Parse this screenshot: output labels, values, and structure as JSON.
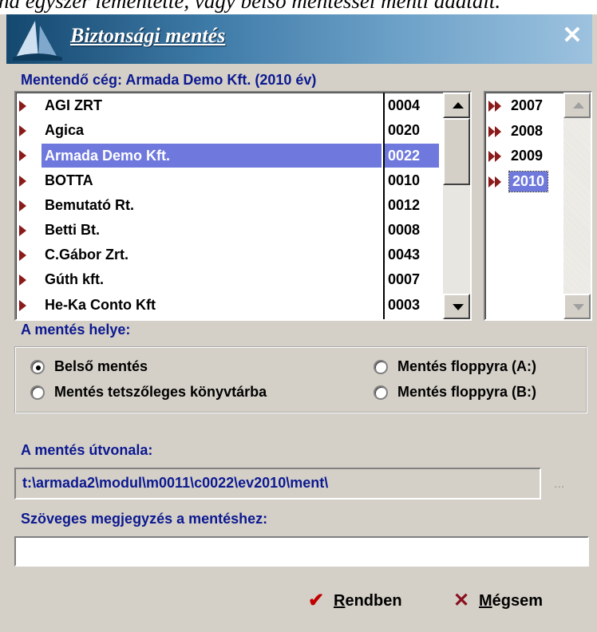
{
  "background_text": "ha egyszer lementette, vagy belső mentéssel menti adatait.",
  "window": {
    "title": "Biztonsági mentés",
    "close_icon": "close-icon"
  },
  "company_section": {
    "label": "Mentendő cég: Armada Demo Kft. (2010 év)"
  },
  "companies": [
    {
      "name": "AGI ZRT",
      "code": "0004"
    },
    {
      "name": "Agica",
      "code": "0020"
    },
    {
      "name": "Armada Demo Kft.",
      "code": "0022"
    },
    {
      "name": "BOTTA",
      "code": "0010"
    },
    {
      "name": "Bemutató Rt.",
      "code": "0012"
    },
    {
      "name": "Betti Bt.",
      "code": "0008"
    },
    {
      "name": "C.Gábor Zrt.",
      "code": "0043"
    },
    {
      "name": "Gúth kft.",
      "code": "0007"
    },
    {
      "name": "He-Ka Conto Kft",
      "code": "0003"
    }
  ],
  "selected_company_index": 2,
  "years": [
    "2007",
    "2008",
    "2009",
    "2010"
  ],
  "selected_year_index": 3,
  "location": {
    "label": "A mentés helye:",
    "options": [
      {
        "label": "Belső mentés",
        "checked": true
      },
      {
        "label": "Mentés tetszőleges könyvtárba",
        "checked": false
      },
      {
        "label": "Mentés floppyra (A:)",
        "checked": false
      },
      {
        "label": "Mentés floppyra (B:)",
        "checked": false
      }
    ]
  },
  "path": {
    "label": "A mentés útvonala:",
    "value": "t:\\armada2\\modul\\m0011\\c0022\\ev2010\\ment\\",
    "browse": "..."
  },
  "note": {
    "label": "Szöveges megjegyzés a mentéshez:",
    "value": ""
  },
  "buttons": {
    "ok_underlined": "R",
    "ok_rest": "endben",
    "cancel_underlined": "M",
    "cancel_rest": "égsem"
  },
  "colors": {
    "title_text": "#ffffff",
    "label_blue": "#0c1990",
    "selection": "#6f79dd",
    "triangle_marker": "#8b1a1a",
    "ok_icon": "#c00000",
    "cancel_icon": "#8b1020"
  }
}
